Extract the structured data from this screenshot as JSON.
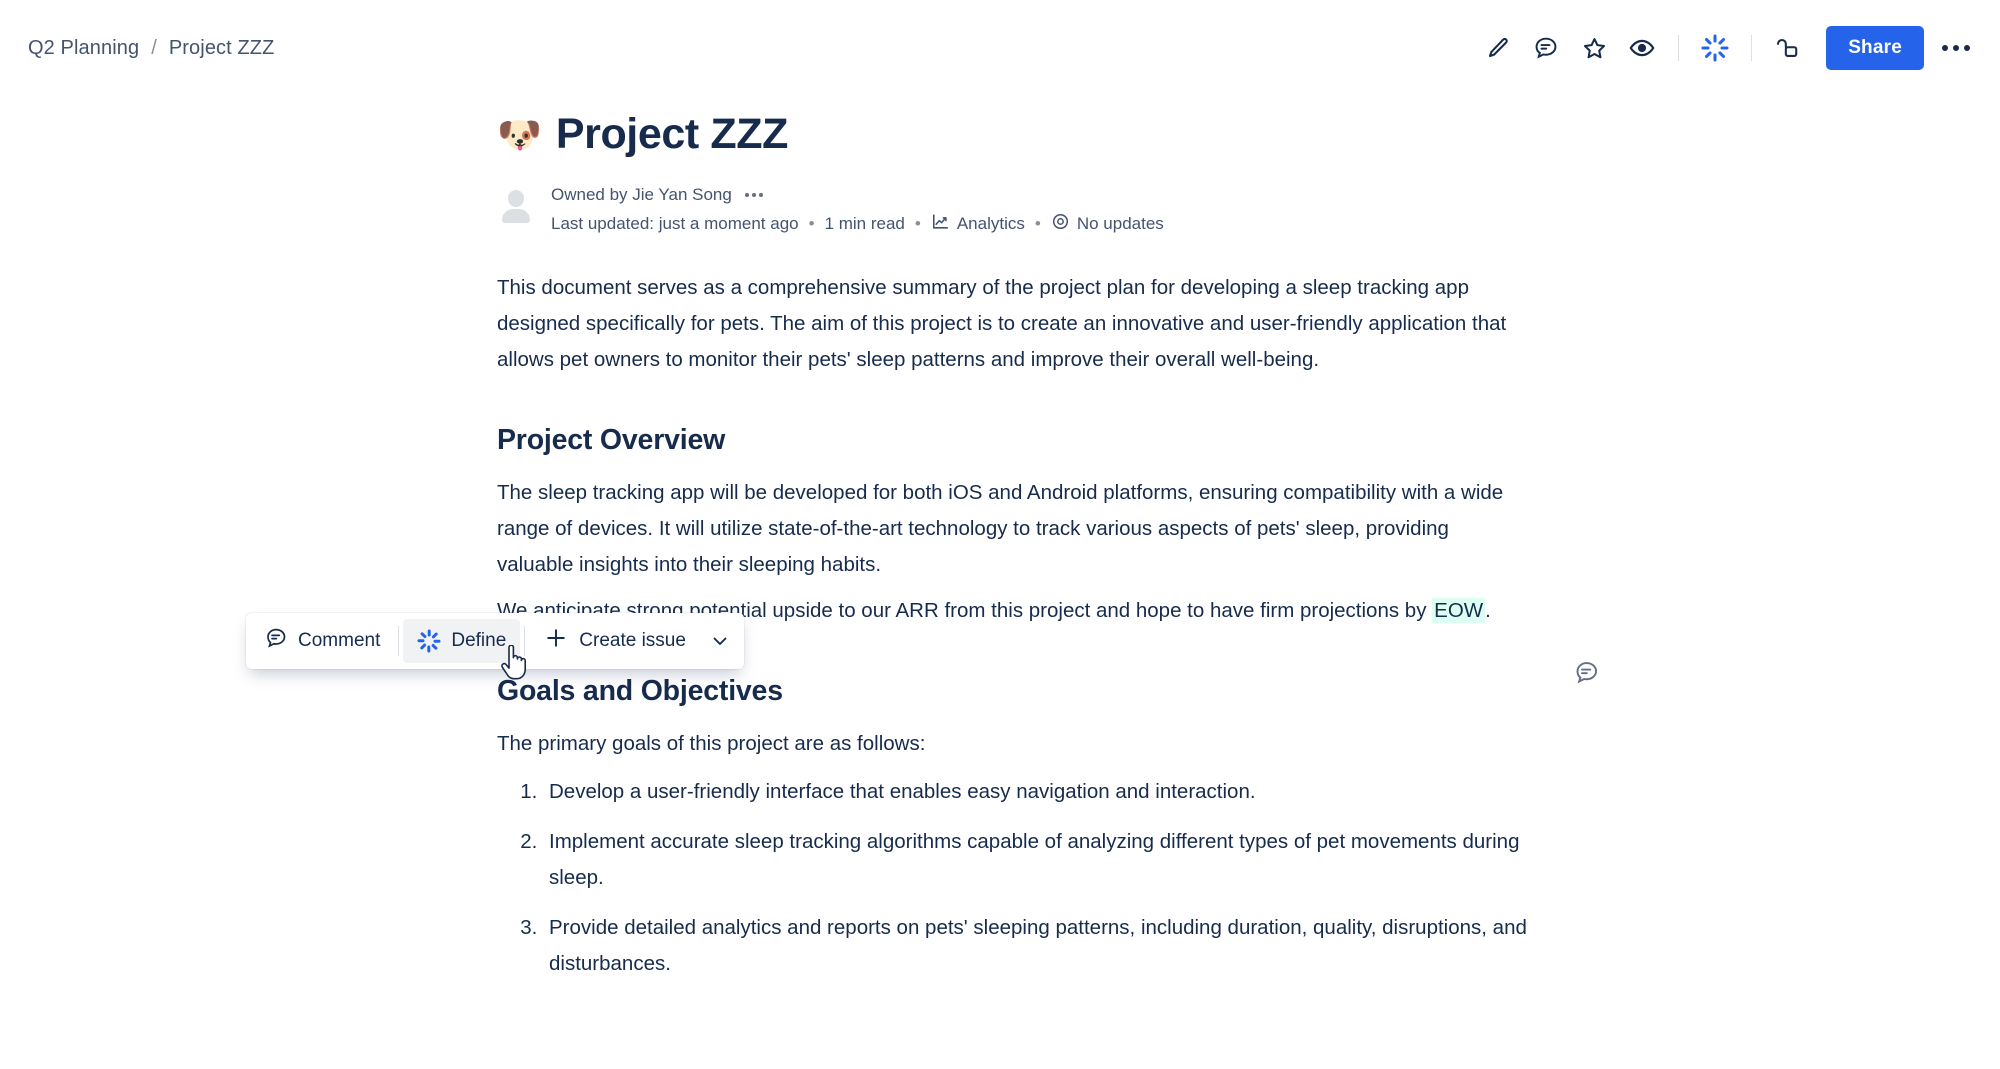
{
  "breadcrumb": {
    "space": "Q2 Planning",
    "separator": "/",
    "page": "Project ZZZ"
  },
  "toolbar": {
    "icons": [
      {
        "name": "edit-pencil-icon",
        "title": "Edit"
      },
      {
        "name": "comment-icon",
        "title": "Comments"
      },
      {
        "name": "star-icon",
        "title": "Star"
      },
      {
        "name": "watch-eye-icon",
        "title": "Watch"
      },
      {
        "name": "ai-sparkle-icon",
        "title": "Atlassian Intelligence"
      },
      {
        "name": "unlock-icon",
        "title": "Restrictions"
      }
    ],
    "share_label": "Share",
    "more_label": "More actions"
  },
  "page": {
    "emoji": "🐶",
    "emoji_name": "dog-face-emoji",
    "title": "Project ZZZ"
  },
  "byline": {
    "owner": "Owned by Jie Yan Song",
    "last_updated": "Last updated: just a moment ago",
    "read_time": "1 min read",
    "analytics": "Analytics",
    "updates": "No updates",
    "bullet": "•"
  },
  "content": {
    "intro": "This document serves as a comprehensive summary of the project plan for developing a sleep tracking app designed specifically for pets. The aim of this project is to create an innovative and user-friendly application that allows pet owners to monitor their pets' sleep patterns and improve their overall well-being.",
    "overview_heading": "Project Overview",
    "overview": "The sleep tracking app will be developed for both iOS and Android platforms, ensuring compatibility with a wide range of devices. It will utilize state-of-the-art technology to track various aspects of pets' sleep, providing valuable insights into their sleeping habits.",
    "arr_before": "We anticipate strong potential upside to our ARR from this project and hope to have firm projections by ",
    "arr_highlight": "EOW",
    "arr_after": ".",
    "goals_heading": "Goals and Objectives",
    "goals_intro": "The primary goals of this project are as follows:",
    "goals": [
      "Develop a user-friendly interface that enables easy navigation and interaction.",
      "Implement accurate sleep tracking algorithms capable of analyzing different types of pet movements during sleep.",
      "Provide detailed analytics and reports on pets' sleeping patterns, including duration, quality, disruptions, and disturbances."
    ]
  },
  "floating_toolbar": {
    "comment_label": "Comment",
    "define_label": "Define",
    "create_issue_label": "Create issue",
    "more_options": "More options"
  },
  "margin": {
    "comment_label": "Add comment"
  },
  "colors": {
    "accent_blue": "#2563EB",
    "text_primary": "#172B4D",
    "text_subtle": "#44546F",
    "highlight_green": "#DCFFF1",
    "hover_grey": "#F1F2F4"
  }
}
